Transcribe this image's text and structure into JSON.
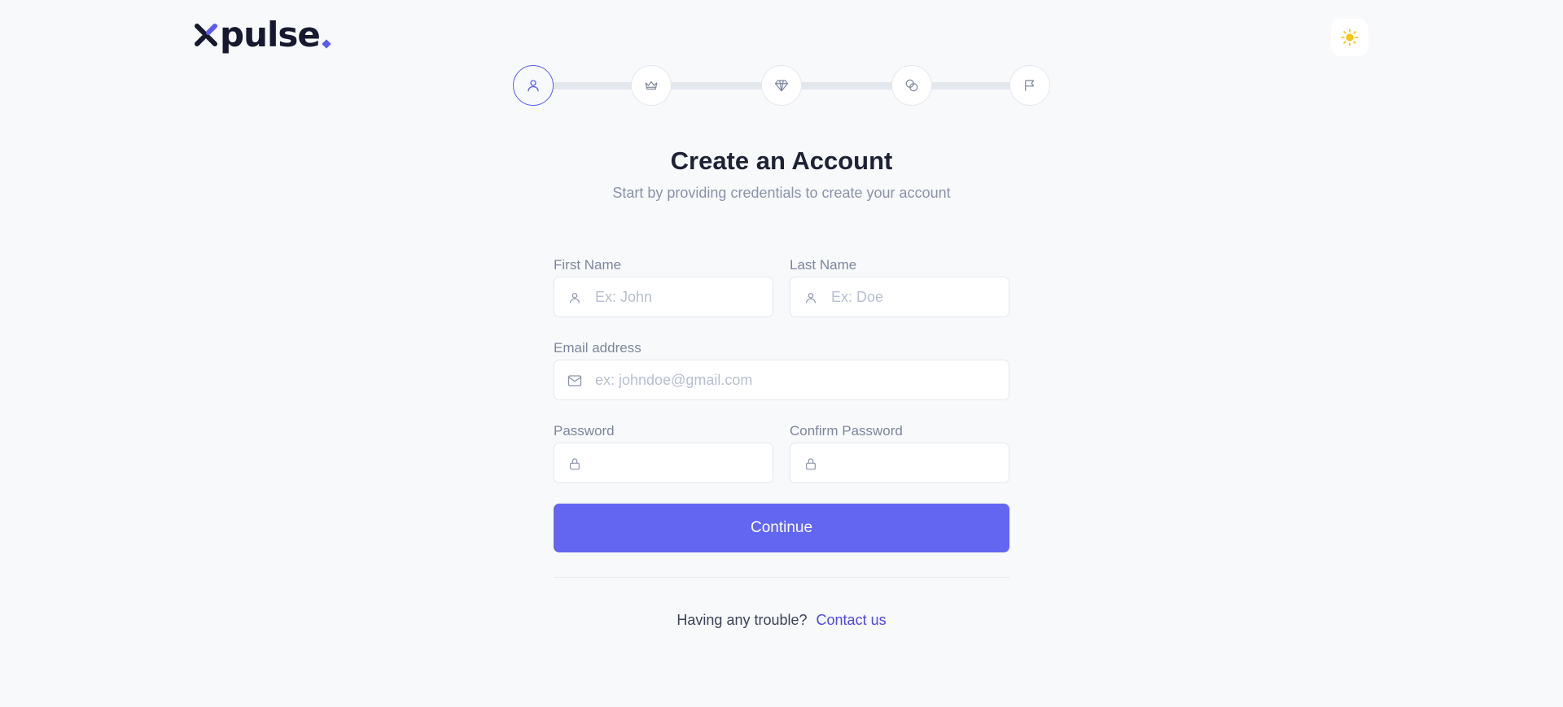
{
  "brand": {
    "name": "pulse",
    "accent": "#5b5bf0"
  },
  "theme_toggle": {
    "icon": "sun-icon",
    "color": "#f5c518"
  },
  "stepper": {
    "steps": [
      {
        "icon": "user-icon",
        "active": true
      },
      {
        "icon": "crown-icon",
        "active": false
      },
      {
        "icon": "diamond-icon",
        "active": false
      },
      {
        "icon": "coins-icon",
        "active": false
      },
      {
        "icon": "flag-icon",
        "active": false
      }
    ]
  },
  "header": {
    "title": "Create an Account",
    "subtitle": "Start by providing credentials to create your account"
  },
  "form": {
    "first_name": {
      "label": "First Name",
      "placeholder": "Ex: John",
      "value": "",
      "icon": "user-icon"
    },
    "last_name": {
      "label": "Last Name",
      "placeholder": "Ex: Doe",
      "value": "",
      "icon": "user-icon"
    },
    "email": {
      "label": "Email address",
      "placeholder": "ex: johndoe@gmail.com",
      "value": "",
      "icon": "mail-icon"
    },
    "password": {
      "label": "Password",
      "placeholder": "",
      "value": "",
      "icon": "lock-icon"
    },
    "confirm_password": {
      "label": "Confirm Password",
      "placeholder": "",
      "value": "",
      "icon": "lock-icon"
    },
    "submit_label": "Continue",
    "submit_color": "#6366f1"
  },
  "footer": {
    "trouble_text": "Having any trouble?",
    "contact_label": "Contact us"
  }
}
